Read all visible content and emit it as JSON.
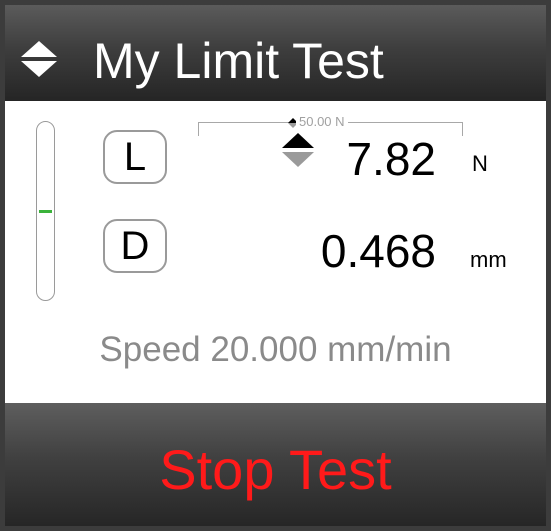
{
  "header": {
    "title": "My Limit Test",
    "icon": "sort-arrows-icon"
  },
  "readings": {
    "load": {
      "key_label": "L",
      "value": "7.82",
      "unit": "N",
      "limit_label": "50.00 N",
      "icon": "load-direction-icon"
    },
    "displacement": {
      "key_label": "D",
      "value": "0.468",
      "unit": "mm"
    },
    "level_indicator": {
      "level_fraction": 0.5,
      "marker_color": "#3bb33b"
    }
  },
  "speed": {
    "text": "Speed 20.000 mm/min"
  },
  "actions": {
    "stop_label": "Stop Test",
    "stop_color": "#ff1a1a"
  }
}
